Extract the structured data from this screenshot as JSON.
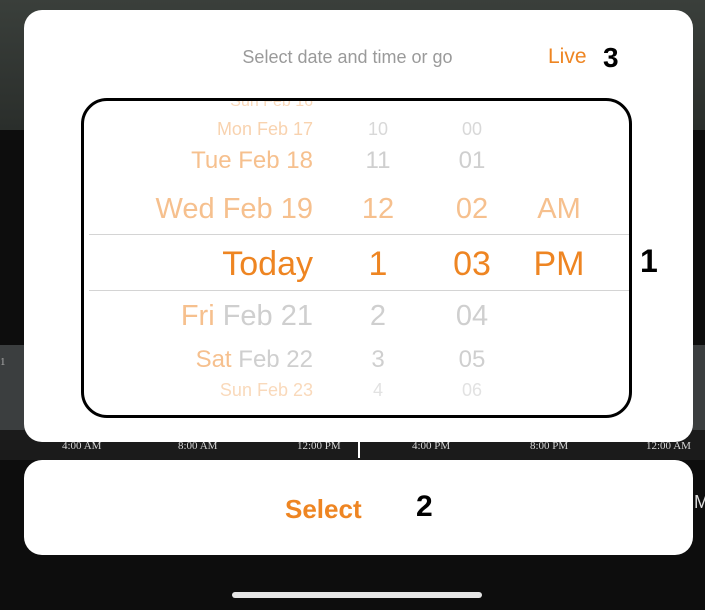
{
  "background": {
    "timeline_labels": [
      "4:00 AM",
      "8:00 AM",
      "12:00 PM",
      "4:00 PM",
      "8:00 PM",
      "12:00 AM"
    ],
    "edge_left": "1",
    "edge_right": "M"
  },
  "picker": {
    "title": "Select date and time or go",
    "live_link": "Live",
    "callouts": {
      "picker": "1",
      "select": "2",
      "live": "3"
    },
    "date_column": {
      "items": [
        "Mon Feb 17",
        "Tue Feb 18",
        "Wed Feb 19",
        "Today",
        "Fri Feb 21",
        "Sat Feb 22",
        "Sun Feb 23"
      ],
      "selected": "Today"
    },
    "hour_column": {
      "items": [
        "10",
        "11",
        "12",
        "1",
        "2",
        "3",
        "4"
      ],
      "selected": "1"
    },
    "minute_column": {
      "items": [
        "00",
        "01",
        "02",
        "03",
        "04",
        "05",
        "06"
      ],
      "selected": "03"
    },
    "ampm_column": {
      "items": [
        "AM",
        "PM"
      ],
      "selected": "PM"
    }
  },
  "select_button": {
    "label": "Select"
  },
  "colors": {
    "accent": "#ee8522",
    "accent_faded": "#f6c08e",
    "muted": "#cfcfcf"
  }
}
